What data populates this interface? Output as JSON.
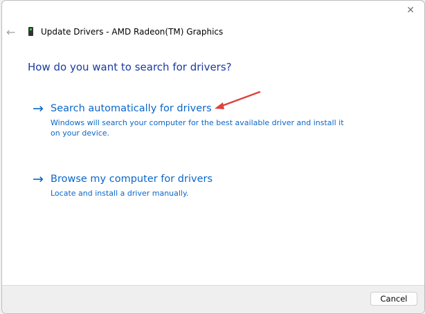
{
  "window": {
    "title": "Update Drivers - AMD Radeon(TM) Graphics",
    "close_icon": "close-icon",
    "back_icon": "back-arrow-icon",
    "device_icon": "display-adapter-icon"
  },
  "heading": "How do you want to search for drivers?",
  "options": [
    {
      "label": "Search automatically for drivers",
      "description": "Windows will search your computer for the best available driver and install it on your device."
    },
    {
      "label": "Browse my computer for drivers",
      "description": "Locate and install a driver manually."
    }
  ],
  "footer": {
    "cancel_label": "Cancel"
  },
  "colors": {
    "link": "#0a66c8",
    "heading": "#1a3aa0",
    "annotation": "#d9443c"
  }
}
